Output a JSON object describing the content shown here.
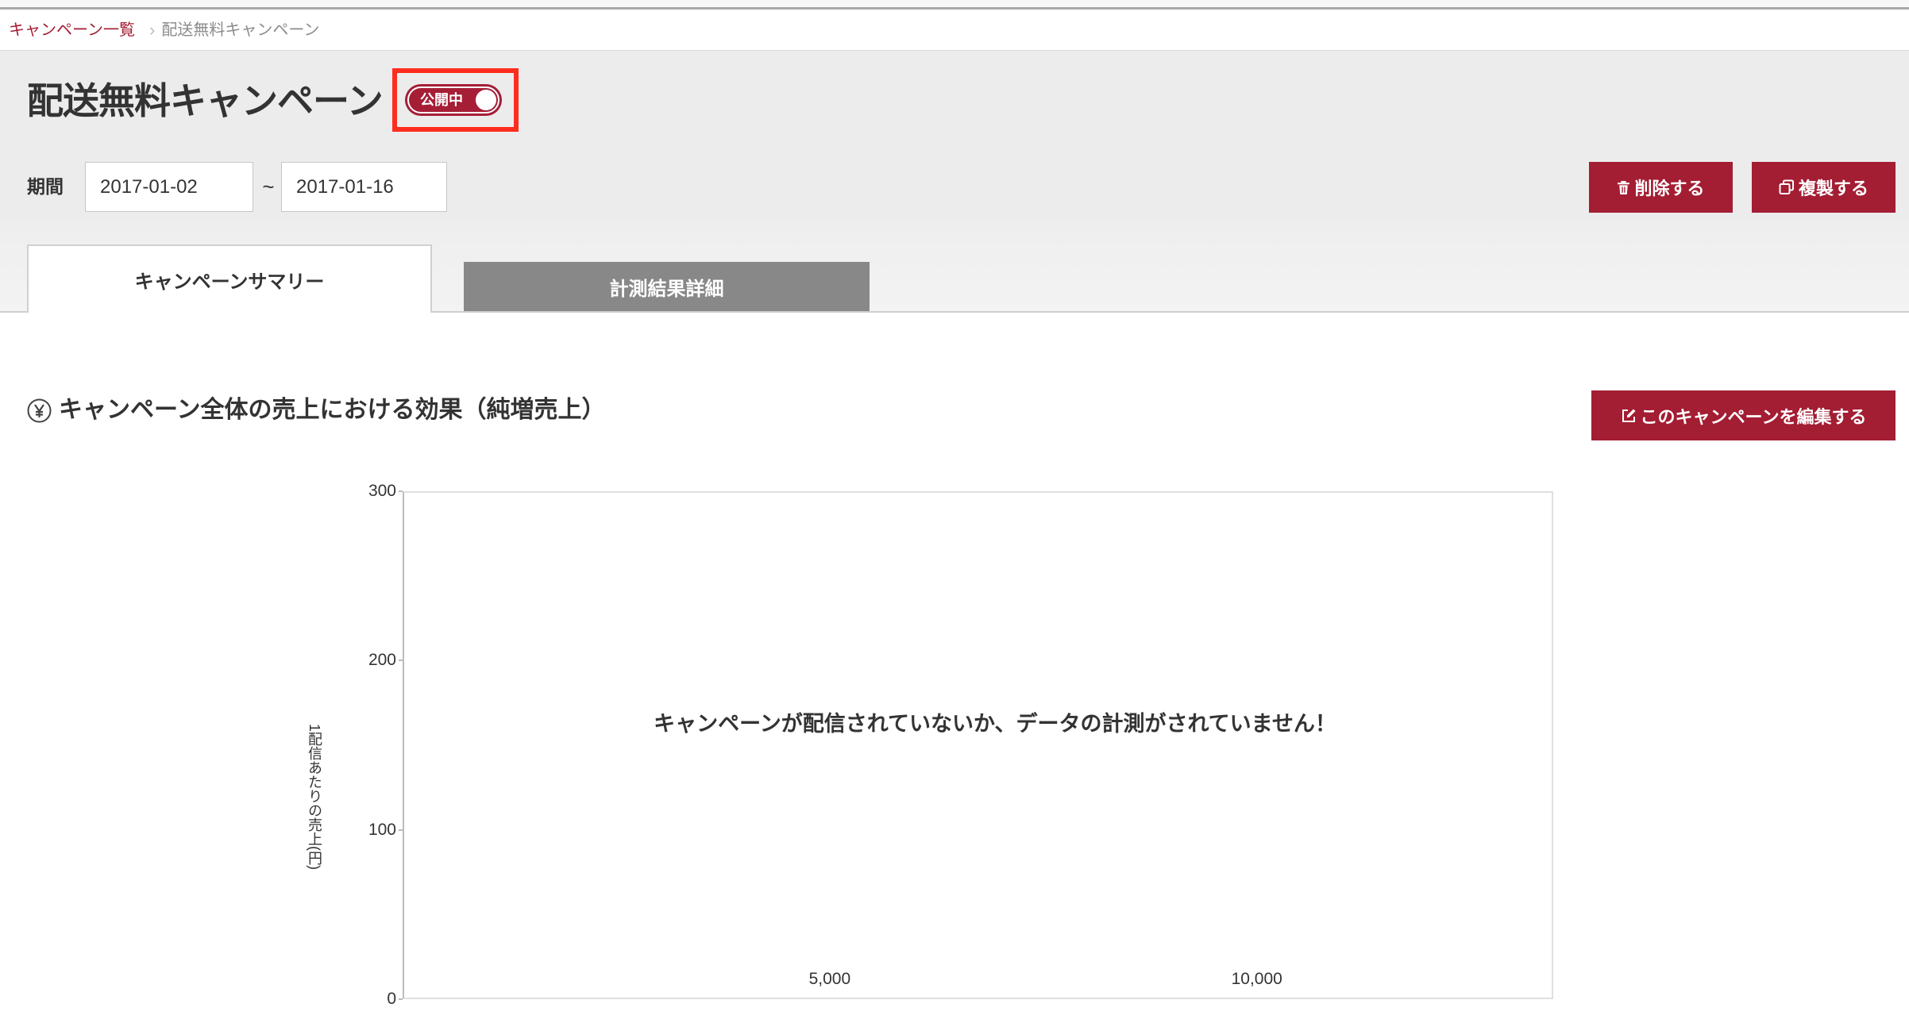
{
  "breadcrumb": {
    "items": [
      {
        "label": "キャンペーン一覧"
      },
      {
        "label": "配送無料キャンペーン"
      }
    ],
    "separator": "›"
  },
  "header": {
    "title": "配送無料キャンペーン",
    "status_toggle": {
      "label": "公開中",
      "on": true
    },
    "period": {
      "label": "期間",
      "start_date": "2017-01-02",
      "range_separator": "~",
      "end_date": "2017-01-16"
    },
    "delete_button": {
      "label": "削除する",
      "icon": "trash-icon"
    },
    "duplicate_button": {
      "label": "複製する",
      "icon": "copy-icon"
    }
  },
  "tabs": [
    {
      "label": "キャンペーンサマリー",
      "active": true
    },
    {
      "label": "計測結果詳細",
      "active": false
    }
  ],
  "summary": {
    "section_icon": "yen-icon",
    "section_title": "キャンペーン全体の売上における効果（純増売上）",
    "edit_button": {
      "label": "このキャンペーンを編集する",
      "icon": "edit-icon"
    }
  },
  "chart_data": {
    "ylabel": "1配信あたりの売上(円)",
    "empty_message": "キャンペーンが配信されていないか、データの計測がされていません！",
    "ylim": [
      0,
      300
    ],
    "xlim": [
      0,
      13470
    ],
    "y_ticks": [
      0,
      100,
      200,
      300
    ],
    "x_ticks": [
      {
        "value": 5000,
        "label": "5,000"
      },
      {
        "value": 10000,
        "label": "10,000"
      }
    ],
    "grid": false,
    "series": []
  },
  "colors": {
    "accent": "#a31d33",
    "highlight_box": "#ff2d1e",
    "inactive_tab": "#888888",
    "header_background": "#ececec"
  }
}
